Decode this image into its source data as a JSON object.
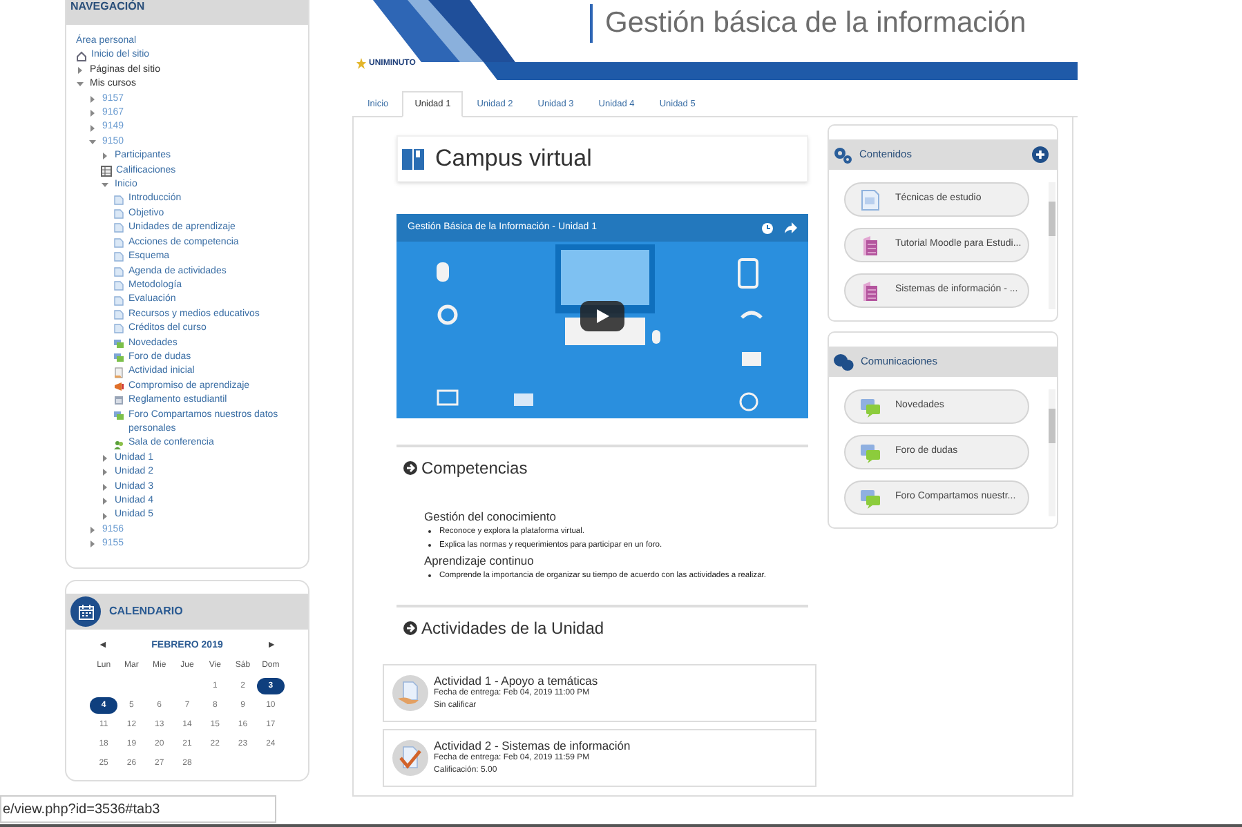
{
  "navigation": {
    "title": "NAVEGACIÓN",
    "items": [
      {
        "label": "Área personal",
        "kind": "link"
      },
      {
        "label": "Inicio del sitio",
        "kind": "home"
      },
      {
        "label": "Páginas del sitio",
        "kind": "category",
        "expanded": false
      },
      {
        "label": "Mis cursos",
        "kind": "category",
        "expanded": true,
        "children": [
          {
            "label": "9157",
            "kind": "course",
            "expanded": false
          },
          {
            "label": "9167",
            "kind": "course",
            "expanded": false
          },
          {
            "label": "9149",
            "kind": "course",
            "expanded": false
          },
          {
            "label": "9150",
            "kind": "course",
            "expanded": true,
            "children": [
              {
                "label": "Participantes",
                "kind": "section",
                "expanded": false
              },
              {
                "label": "Calificaciones",
                "kind": "grades"
              },
              {
                "label": "Inicio",
                "kind": "section",
                "expanded": true,
                "children": [
                  {
                    "label": "Introducción",
                    "kind": "page"
                  },
                  {
                    "label": "Objetivo",
                    "kind": "page"
                  },
                  {
                    "label": "Unidades de aprendizaje",
                    "kind": "page"
                  },
                  {
                    "label": "Acciones de competencia",
                    "kind": "page"
                  },
                  {
                    "label": "Esquema",
                    "kind": "page"
                  },
                  {
                    "label": "Agenda de actividades",
                    "kind": "page"
                  },
                  {
                    "label": "Metodología",
                    "kind": "page"
                  },
                  {
                    "label": "Evaluación",
                    "kind": "page"
                  },
                  {
                    "label": "Recursos y medios educativos",
                    "kind": "page"
                  },
                  {
                    "label": "Créditos del curso",
                    "kind": "page"
                  },
                  {
                    "label": "Novedades",
                    "kind": "forum"
                  },
                  {
                    "label": "Foro de dudas",
                    "kind": "forum"
                  },
                  {
                    "label": "Actividad inicial",
                    "kind": "quiz"
                  },
                  {
                    "label": "Compromiso de aprendizaje",
                    "kind": "feedback"
                  },
                  {
                    "label": "Reglamento estudiantil",
                    "kind": "file"
                  },
                  {
                    "label": "Foro Compartamos nuestros datos personales",
                    "kind": "forum"
                  },
                  {
                    "label": "Sala de conferencia",
                    "kind": "conference"
                  }
                ]
              },
              {
                "label": "Unidad 1",
                "kind": "section",
                "expanded": false
              },
              {
                "label": "Unidad 2",
                "kind": "section",
                "expanded": false
              },
              {
                "label": "Unidad 3",
                "kind": "section",
                "expanded": false
              },
              {
                "label": "Unidad 4",
                "kind": "section",
                "expanded": false
              },
              {
                "label": "Unidad 5",
                "kind": "section",
                "expanded": false
              }
            ]
          },
          {
            "label": "9156",
            "kind": "course",
            "expanded": false
          },
          {
            "label": "9155",
            "kind": "course",
            "expanded": false
          }
        ]
      }
    ]
  },
  "calendar": {
    "title": "CALENDARIO",
    "prev": "◄",
    "month": "FEBRERO 2019",
    "next": "►",
    "weekdays": [
      "Lun",
      "Mar",
      "Mie",
      "Jue",
      "Vie",
      "Sáb",
      "Dom"
    ],
    "weeks": [
      [
        {
          "day": "1",
          "highlighted": false
        },
        {
          "day": "2",
          "highlighted": false
        },
        {
          "day": "3",
          "highlighted": true
        }
      ],
      [
        {
          "day": "4",
          "highlighted": true
        },
        {
          "day": "5",
          "highlighted": false
        },
        {
          "day": "6",
          "highlighted": false
        },
        {
          "day": "7",
          "highlighted": false
        },
        {
          "day": "8",
          "highlighted": false
        },
        {
          "day": "9",
          "highlighted": false
        },
        {
          "day": "10",
          "highlighted": false
        }
      ],
      [
        {
          "day": "11",
          "highlighted": false
        },
        {
          "day": "12",
          "highlighted": false
        },
        {
          "day": "13",
          "highlighted": false
        },
        {
          "day": "14",
          "highlighted": false
        },
        {
          "day": "15",
          "highlighted": false
        },
        {
          "day": "16",
          "highlighted": false
        },
        {
          "day": "17",
          "highlighted": false
        }
      ],
      [
        {
          "day": "18",
          "highlighted": false
        },
        {
          "day": "19",
          "highlighted": false
        },
        {
          "day": "20",
          "highlighted": false
        },
        {
          "day": "21",
          "highlighted": false
        },
        {
          "day": "22",
          "highlighted": false
        },
        {
          "day": "23",
          "highlighted": false
        },
        {
          "day": "24",
          "highlighted": false
        }
      ],
      [
        {
          "day": "25",
          "highlighted": false
        },
        {
          "day": "26",
          "highlighted": false
        },
        {
          "day": "27",
          "highlighted": false
        },
        {
          "day": "28",
          "highlighted": false
        }
      ]
    ]
  },
  "status_bar": {
    "url": "e/view.php?id=3536#tab3"
  },
  "header": {
    "logo": "UNIMINUTO",
    "title": "Gestión básica de la información"
  },
  "tabs": [
    {
      "label": "Inicio",
      "selected": false
    },
    {
      "label": "Unidad 1",
      "selected": true
    },
    {
      "label": "Unidad 2",
      "selected": false
    },
    {
      "label": "Unidad 3",
      "selected": false
    },
    {
      "label": "Unidad 4",
      "selected": false
    },
    {
      "label": "Unidad 5",
      "selected": false
    }
  ],
  "main": {
    "heading": "Campus virtual",
    "video": {
      "title": "Gestión Básica de la Información - Unidad 1"
    },
    "competencias": {
      "heading": "Competencias",
      "groups": [
        {
          "title": "Gestión del conocimiento",
          "bullets": [
            "Reconoce y explora la plataforma virtual.",
            "Explica las normas y requerimientos para participar en un foro."
          ]
        },
        {
          "title": "Aprendizaje continuo",
          "bullets": [
            "Comprende la importancia de organizar su tiempo de acuerdo con las actividades a realizar."
          ]
        }
      ]
    },
    "activities": {
      "heading": "Actividades de la Unidad",
      "items": [
        {
          "kind": "upload",
          "title": "Actividad 1 - Apoyo a temáticas",
          "due": "Fecha de entrega: Feb 04, 2019 11:00 PM",
          "status": "Sin calificar"
        },
        {
          "kind": "graded",
          "title": "Actividad 2 - Sistemas de información",
          "due": "Fecha de entrega: Feb 04, 2019 11:59 PM",
          "status": "Calificación: 5.00"
        }
      ]
    }
  },
  "blocks": [
    {
      "title": "Contenidos",
      "kind": "contents",
      "add_button": true,
      "items": [
        {
          "label": "Técnicas de estudio",
          "kind": "page"
        },
        {
          "label": "Tutorial Moodle para Estudi...",
          "kind": "file"
        },
        {
          "label": "Sistemas de información - ...",
          "kind": "file"
        }
      ]
    },
    {
      "title": "Comunicaciones",
      "kind": "communications",
      "add_button": false,
      "items": [
        {
          "label": "Novedades",
          "kind": "forum"
        },
        {
          "label": "Foro de dudas",
          "kind": "forum"
        },
        {
          "label": "Foro Compartamos nuestr...",
          "kind": "forum"
        }
      ]
    }
  ]
}
